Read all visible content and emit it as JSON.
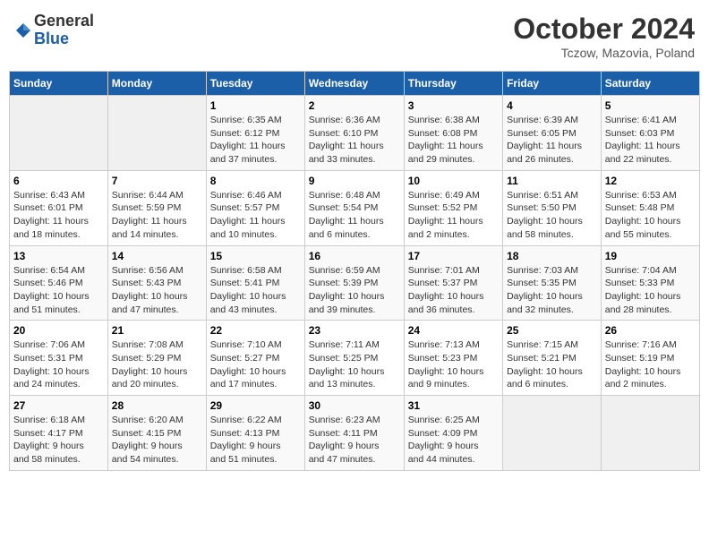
{
  "header": {
    "logo_general": "General",
    "logo_blue": "Blue",
    "month_title": "October 2024",
    "location": "Tczow, Mazovia, Poland"
  },
  "days_of_week": [
    "Sunday",
    "Monday",
    "Tuesday",
    "Wednesday",
    "Thursday",
    "Friday",
    "Saturday"
  ],
  "weeks": [
    [
      {
        "day": "",
        "info": ""
      },
      {
        "day": "",
        "info": ""
      },
      {
        "day": "1",
        "info": "Sunrise: 6:35 AM\nSunset: 6:12 PM\nDaylight: 11 hours\nand 37 minutes."
      },
      {
        "day": "2",
        "info": "Sunrise: 6:36 AM\nSunset: 6:10 PM\nDaylight: 11 hours\nand 33 minutes."
      },
      {
        "day": "3",
        "info": "Sunrise: 6:38 AM\nSunset: 6:08 PM\nDaylight: 11 hours\nand 29 minutes."
      },
      {
        "day": "4",
        "info": "Sunrise: 6:39 AM\nSunset: 6:05 PM\nDaylight: 11 hours\nand 26 minutes."
      },
      {
        "day": "5",
        "info": "Sunrise: 6:41 AM\nSunset: 6:03 PM\nDaylight: 11 hours\nand 22 minutes."
      }
    ],
    [
      {
        "day": "6",
        "info": "Sunrise: 6:43 AM\nSunset: 6:01 PM\nDaylight: 11 hours\nand 18 minutes."
      },
      {
        "day": "7",
        "info": "Sunrise: 6:44 AM\nSunset: 5:59 PM\nDaylight: 11 hours\nand 14 minutes."
      },
      {
        "day": "8",
        "info": "Sunrise: 6:46 AM\nSunset: 5:57 PM\nDaylight: 11 hours\nand 10 minutes."
      },
      {
        "day": "9",
        "info": "Sunrise: 6:48 AM\nSunset: 5:54 PM\nDaylight: 11 hours\nand 6 minutes."
      },
      {
        "day": "10",
        "info": "Sunrise: 6:49 AM\nSunset: 5:52 PM\nDaylight: 11 hours\nand 2 minutes."
      },
      {
        "day": "11",
        "info": "Sunrise: 6:51 AM\nSunset: 5:50 PM\nDaylight: 10 hours\nand 58 minutes."
      },
      {
        "day": "12",
        "info": "Sunrise: 6:53 AM\nSunset: 5:48 PM\nDaylight: 10 hours\nand 55 minutes."
      }
    ],
    [
      {
        "day": "13",
        "info": "Sunrise: 6:54 AM\nSunset: 5:46 PM\nDaylight: 10 hours\nand 51 minutes."
      },
      {
        "day": "14",
        "info": "Sunrise: 6:56 AM\nSunset: 5:43 PM\nDaylight: 10 hours\nand 47 minutes."
      },
      {
        "day": "15",
        "info": "Sunrise: 6:58 AM\nSunset: 5:41 PM\nDaylight: 10 hours\nand 43 minutes."
      },
      {
        "day": "16",
        "info": "Sunrise: 6:59 AM\nSunset: 5:39 PM\nDaylight: 10 hours\nand 39 minutes."
      },
      {
        "day": "17",
        "info": "Sunrise: 7:01 AM\nSunset: 5:37 PM\nDaylight: 10 hours\nand 36 minutes."
      },
      {
        "day": "18",
        "info": "Sunrise: 7:03 AM\nSunset: 5:35 PM\nDaylight: 10 hours\nand 32 minutes."
      },
      {
        "day": "19",
        "info": "Sunrise: 7:04 AM\nSunset: 5:33 PM\nDaylight: 10 hours\nand 28 minutes."
      }
    ],
    [
      {
        "day": "20",
        "info": "Sunrise: 7:06 AM\nSunset: 5:31 PM\nDaylight: 10 hours\nand 24 minutes."
      },
      {
        "day": "21",
        "info": "Sunrise: 7:08 AM\nSunset: 5:29 PM\nDaylight: 10 hours\nand 20 minutes."
      },
      {
        "day": "22",
        "info": "Sunrise: 7:10 AM\nSunset: 5:27 PM\nDaylight: 10 hours\nand 17 minutes."
      },
      {
        "day": "23",
        "info": "Sunrise: 7:11 AM\nSunset: 5:25 PM\nDaylight: 10 hours\nand 13 minutes."
      },
      {
        "day": "24",
        "info": "Sunrise: 7:13 AM\nSunset: 5:23 PM\nDaylight: 10 hours\nand 9 minutes."
      },
      {
        "day": "25",
        "info": "Sunrise: 7:15 AM\nSunset: 5:21 PM\nDaylight: 10 hours\nand 6 minutes."
      },
      {
        "day": "26",
        "info": "Sunrise: 7:16 AM\nSunset: 5:19 PM\nDaylight: 10 hours\nand 2 minutes."
      }
    ],
    [
      {
        "day": "27",
        "info": "Sunrise: 6:18 AM\nSunset: 4:17 PM\nDaylight: 9 hours\nand 58 minutes."
      },
      {
        "day": "28",
        "info": "Sunrise: 6:20 AM\nSunset: 4:15 PM\nDaylight: 9 hours\nand 54 minutes."
      },
      {
        "day": "29",
        "info": "Sunrise: 6:22 AM\nSunset: 4:13 PM\nDaylight: 9 hours\nand 51 minutes."
      },
      {
        "day": "30",
        "info": "Sunrise: 6:23 AM\nSunset: 4:11 PM\nDaylight: 9 hours\nand 47 minutes."
      },
      {
        "day": "31",
        "info": "Sunrise: 6:25 AM\nSunset: 4:09 PM\nDaylight: 9 hours\nand 44 minutes."
      },
      {
        "day": "",
        "info": ""
      },
      {
        "day": "",
        "info": ""
      }
    ]
  ]
}
